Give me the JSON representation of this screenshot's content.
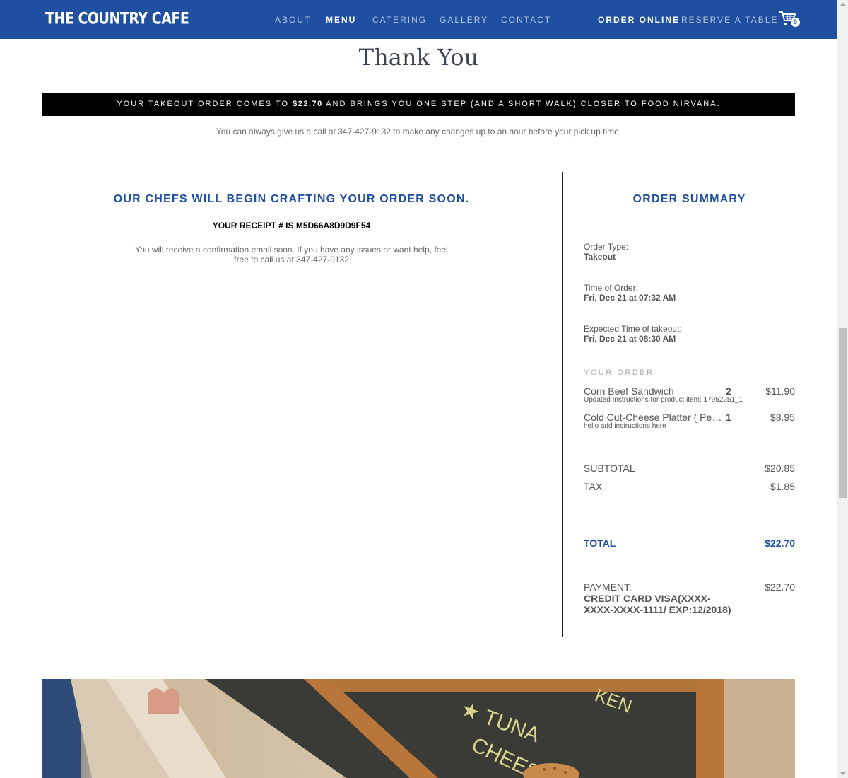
{
  "nav": {
    "logo": "THE COUNTRY CAFE",
    "links": [
      "ABOUT",
      "MENU",
      "CATERING",
      "GALLERY",
      "CONTACT"
    ],
    "order_online": "ORDER ONLINE",
    "reserve": "RESERVE A TABLE",
    "cart_count": "0"
  },
  "page": {
    "title": "Thank You",
    "banner_pre": "YOUR TAKEOUT ORDER COMES TO ",
    "banner_amount": "$22.70",
    "banner_post": " AND BRINGS YOU ONE STEP (AND A SHORT WALK) CLOSER TO FOOD NIRVANA.",
    "call_note": "You can always give us a call at 347-427-9132 to make any changes up to an hour before your pick up time."
  },
  "confirmation": {
    "title": "OUR CHEFS WILL BEGIN CRAFTING YOUR ORDER SOON.",
    "receipt": "YOUR RECEIPT # IS M5D66A8D9D9F54",
    "message": "You will receive a confirmation email soon. If you have any issues or want help, feel free to call us at 347-427-9132"
  },
  "summary": {
    "title": "ORDER SUMMARY",
    "order_type_label": "Order Type:",
    "order_type": "Takeout",
    "time_label": "Time of Order:",
    "time": "Fri, Dec 21 at 07:32 AM",
    "expected_label": "Expected Time of takeout:",
    "expected": "Fri, Dec 21 at 08:30 AM",
    "your_order": "YOUR ORDER",
    "items": [
      {
        "name": "Corn Beef Sandwich",
        "qty": "2",
        "price": "$11.90",
        "note": "Updated Instructions for product item: 17952251_1"
      },
      {
        "name": "Cold Cut-Cheese Platter ( Per Person )",
        "qty": "1",
        "price": "$8.95",
        "note": "hello add instructions here"
      }
    ],
    "subtotal_label": "SUBTOTAL",
    "subtotal": "$20.85",
    "tax_label": "TAX",
    "tax": "$1.85",
    "total_label": "TOTAL",
    "total": "$22.70",
    "payment_label": "PAYMENT:",
    "payment_method": "CREDIT CARD VISA(XXXX-XXXX-XXXX-1111/ EXP:12/2018)",
    "payment_amount": "$22.70"
  },
  "colors": {
    "brand_blue": "#1f4fa0",
    "banner_bg": "#000000"
  }
}
